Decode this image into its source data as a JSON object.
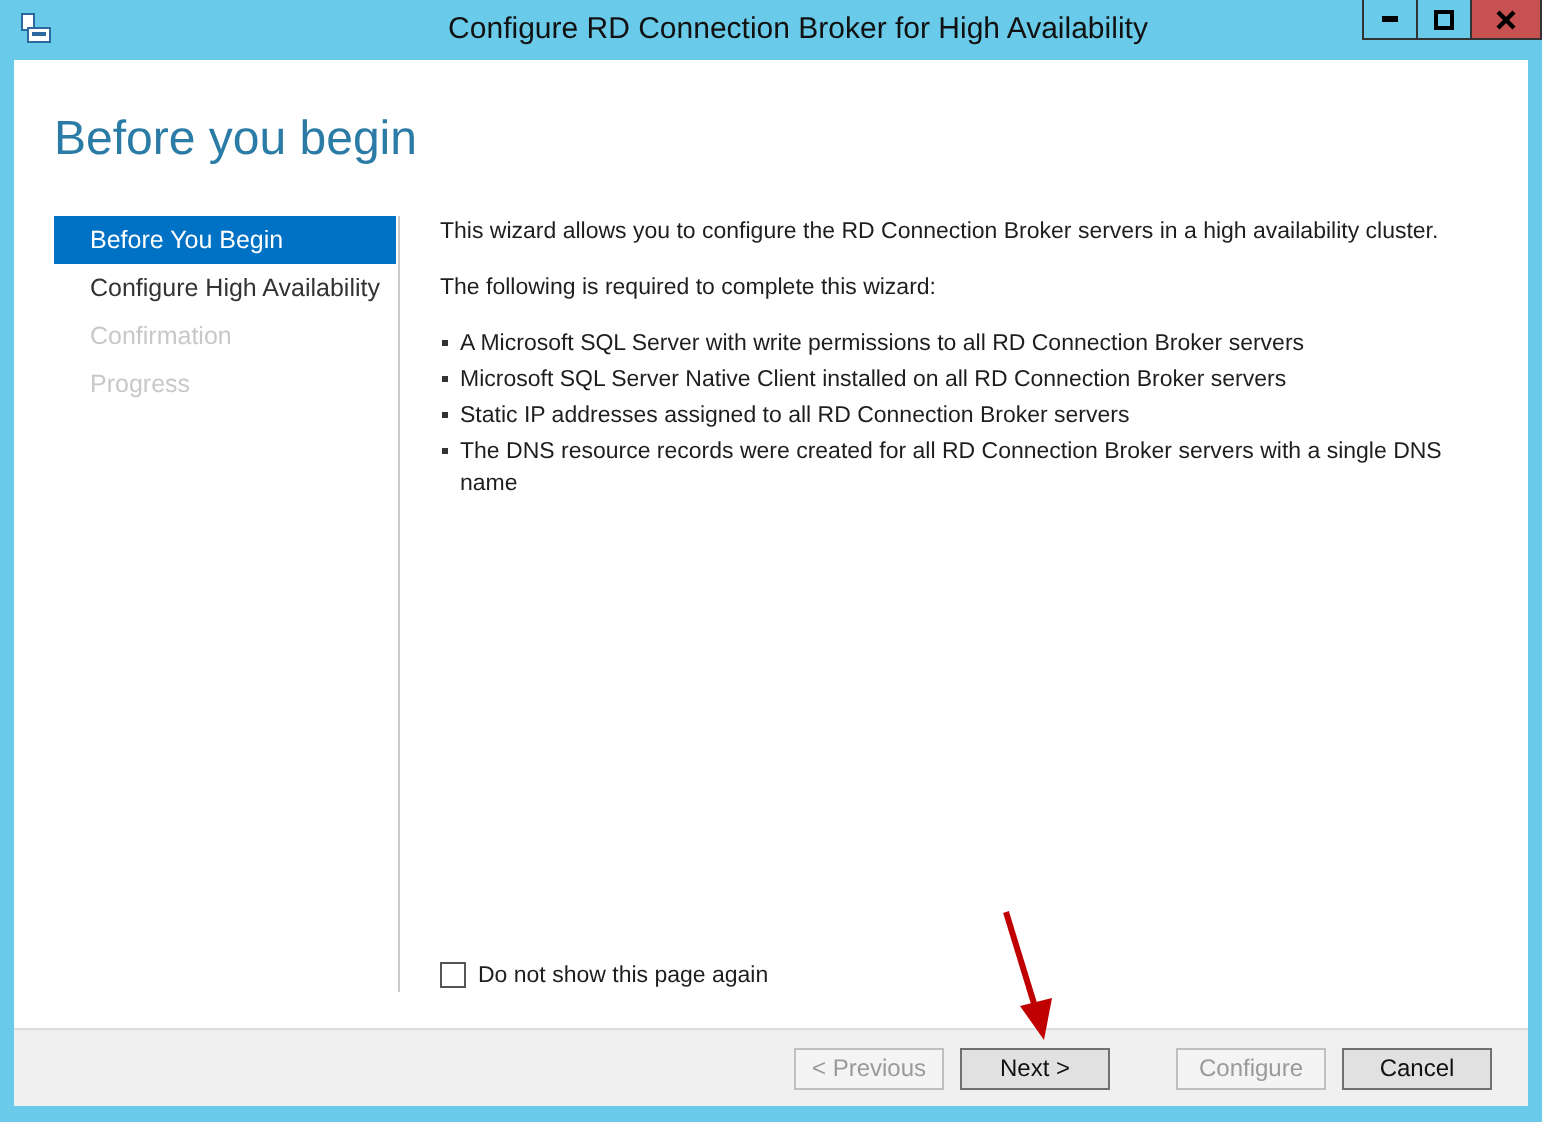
{
  "window": {
    "title": "Configure RD Connection Broker for High Availability"
  },
  "heading": "Before you begin",
  "steps": [
    {
      "label": "Before You Begin",
      "selected": true,
      "disabled": false
    },
    {
      "label": "Configure High Availability",
      "selected": false,
      "disabled": false
    },
    {
      "label": "Confirmation",
      "selected": false,
      "disabled": true
    },
    {
      "label": "Progress",
      "selected": false,
      "disabled": true
    }
  ],
  "intro": "This wizard allows you to configure the RD Connection Broker servers in a high availability cluster.",
  "requirements_heading": "The following is required to complete this wizard:",
  "requirements": [
    "A Microsoft SQL Server with write permissions to all RD Connection Broker servers",
    "Microsoft SQL Server Native Client installed on all RD Connection Broker servers",
    "Static IP addresses assigned to all RD Connection Broker servers",
    "The DNS resource records were created for all RD Connection Broker servers with a single DNS name"
  ],
  "checkbox": {
    "label": "Do not show this page again",
    "checked": false
  },
  "buttons": [
    {
      "label": "< Previous",
      "disabled": true
    },
    {
      "label": "Next >",
      "disabled": false
    },
    {
      "label": "Configure",
      "disabled": true
    },
    {
      "label": "Cancel",
      "disabled": false
    }
  ]
}
